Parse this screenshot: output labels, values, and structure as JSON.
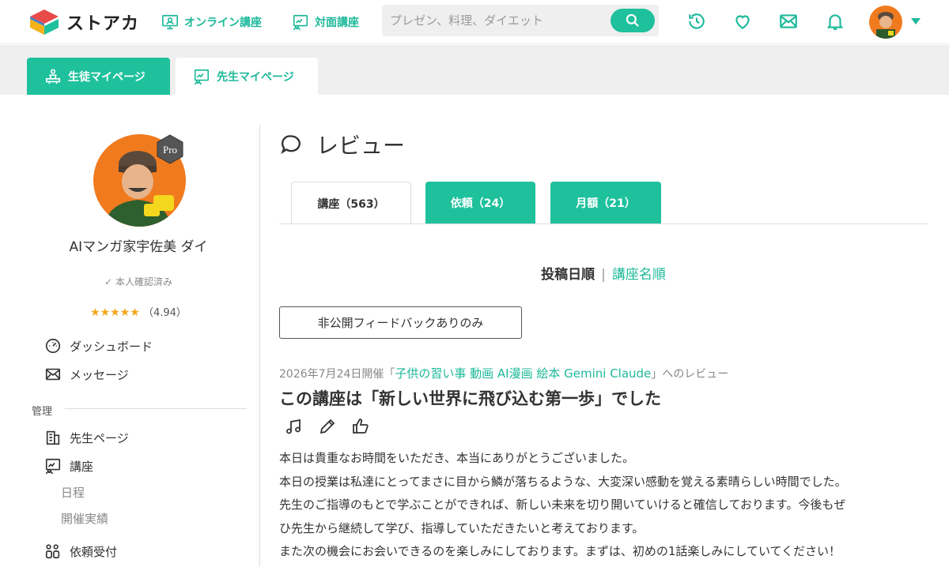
{
  "header": {
    "logo_text": "ストアカ",
    "nav_online": "オンライン講座",
    "nav_offline": "対面講座",
    "search_placeholder": "プレゼン、料理、ダイエット"
  },
  "page_tabs": {
    "student": "生徒マイページ",
    "teacher": "先生マイページ"
  },
  "profile": {
    "name": "AIマンガ家宇佐美 ダイ",
    "verified": "本人確認済み",
    "stars": "★★★★★",
    "rating": "（4.94）",
    "badge": "Pro"
  },
  "sidebar": {
    "dashboard": "ダッシュボード",
    "message": "メッセージ",
    "section_manage": "管理",
    "teacher_page": "先生ページ",
    "course": "講座",
    "schedule": "日程",
    "history": "開催実績",
    "requests": "依頼受付"
  },
  "main": {
    "heading": "レビュー",
    "tabs": [
      {
        "label": "講座（563）"
      },
      {
        "label": "依頼（24）"
      },
      {
        "label": "月額（21）"
      }
    ],
    "sort_date": "投稿日順",
    "sort_sep": "|",
    "sort_name": "講座名順",
    "filter_button": "非公開フィードバックありのみ",
    "review": {
      "date_prefix": "2026年7月24日開催「",
      "course_name": "子供の習い事 動画 AI漫画 絵本 Gemini Claude",
      "suffix": "」へのレビュー",
      "title": "この講座は「新しい世界に飛び込む第一歩」でした",
      "lines": [
        "本日は貴重なお時間をいただき、本当にありがとうございました。",
        "本日の授業は私達にとってまさに目から鱗が落ちるような、大変深い感動を覚える素晴らしい時間でした。",
        "先生のご指導のもとで学ぶことができれば、新しい未来を切り開いていけると確信しております。今後もぜ",
        "ひ先生から継続して学び、指導していただきたいと考えております。",
        "また次の機会にお会いできるのを楽しみにしております。まずは、初めの1話楽しみにしていてください！"
      ]
    }
  },
  "colors": {
    "accent": "#1ec19c",
    "star": "#f3a51b"
  }
}
